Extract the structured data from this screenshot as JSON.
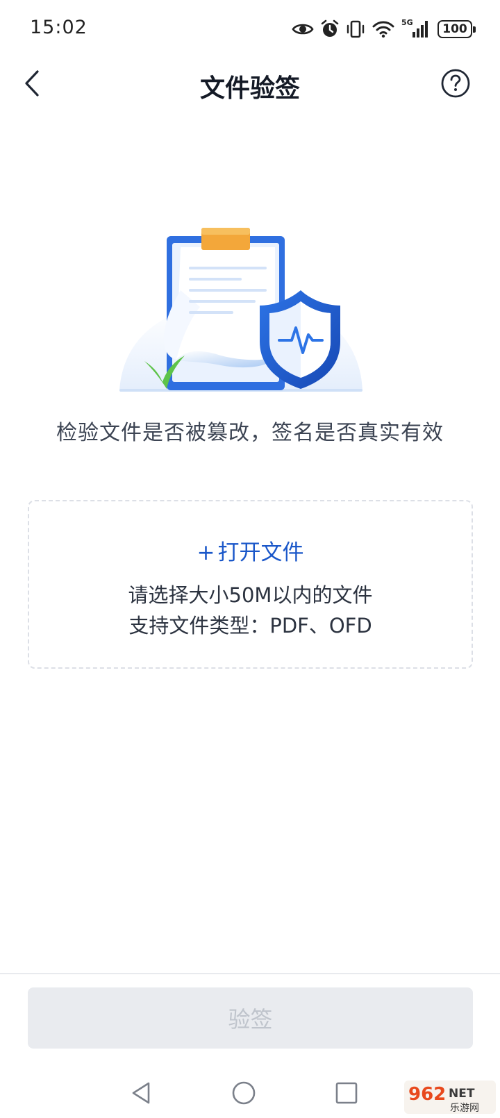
{
  "status_bar": {
    "time": "15:02",
    "network_label": "5G",
    "battery_level": "100",
    "icons": [
      "eye-icon",
      "alarm-icon",
      "vibrate-icon",
      "wifi-icon",
      "signal-icon",
      "battery-icon"
    ]
  },
  "header": {
    "title": "文件验签",
    "back_icon": "chevron-left-icon",
    "help_icon": "question-circle-icon"
  },
  "illustration": {
    "description_icon": "document-shield-illustration"
  },
  "tagline": "检验文件是否被篡改，签名是否真实有效",
  "upload": {
    "plus": "+",
    "open_label": "打开文件",
    "hint_size": "请选择大小50M以内的文件",
    "hint_types": "支持文件类型：PDF、OFD"
  },
  "footer": {
    "verify_label": "验签",
    "verify_enabled": false
  },
  "nav": {
    "back_icon": "nav-back-icon",
    "home_icon": "nav-home-icon",
    "recents_icon": "nav-recents-icon"
  },
  "watermark": {
    "brand": "962",
    "suffix": "NET",
    "sub": "乐游网"
  },
  "colors": {
    "accent": "#1a57c9",
    "disabled_bg": "#e9ebef",
    "disabled_text": "#bfc4cc",
    "shield_blue": "#1f5fd1",
    "clip_orange": "#f3a73a",
    "check_green": "#5ec34a"
  }
}
